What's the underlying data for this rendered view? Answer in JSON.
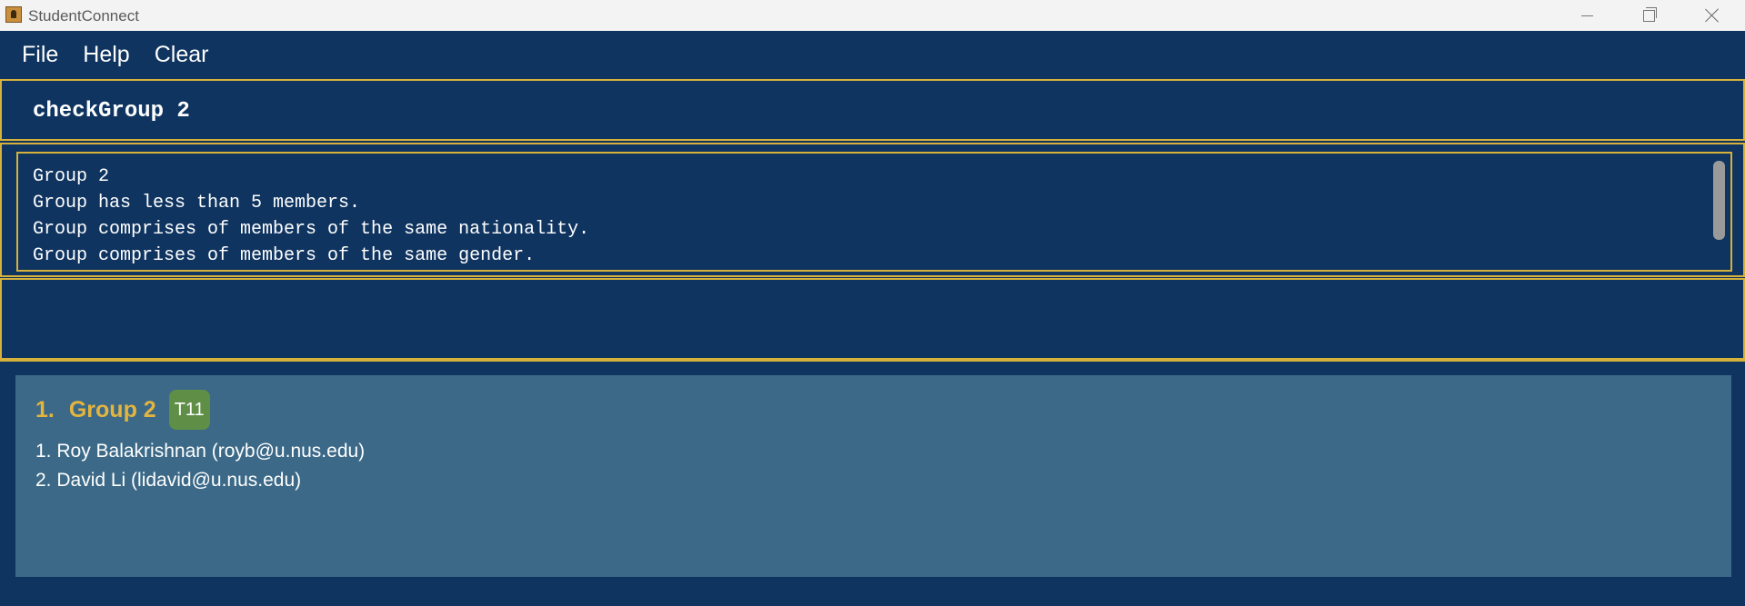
{
  "window": {
    "title": "StudentConnect",
    "icons": {
      "app": "app-icon",
      "minimize": "minimize-icon",
      "maximize": "restore-icon",
      "close": "close-icon"
    }
  },
  "menu": {
    "file": "File",
    "help": "Help",
    "clear": "Clear"
  },
  "command": {
    "text": "checkGroup 2"
  },
  "result": {
    "lines": [
      "Group 2",
      "Group has less than 5 members.",
      "Group comprises of members of the same nationality.",
      "Group comprises of members of the same gender."
    ]
  },
  "groups": [
    {
      "index": "1.",
      "name": "Group 2",
      "tag": "T11",
      "members": [
        "1. Roy Balakrishnan (royb@u.nus.edu)",
        "2. David Li (lidavid@u.nus.edu)"
      ]
    }
  ],
  "colors": {
    "background": "#0f3460",
    "border_accent": "#d6b13c",
    "card": "#3b6987",
    "group_title": "#e3b53f",
    "tag": "#5f8f46"
  }
}
